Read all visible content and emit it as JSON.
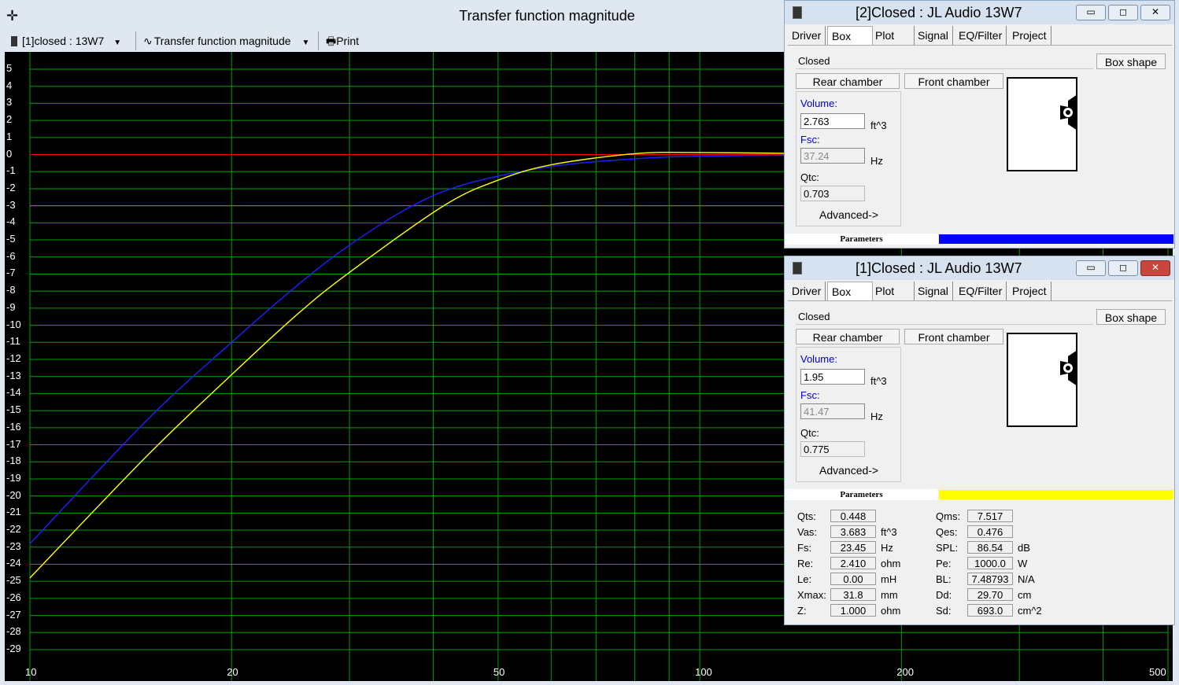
{
  "window": {
    "title": "Transfer function magnitude"
  },
  "toolbar": {
    "project_select": "[1]closed : 13W7",
    "view_select": "Transfer function magnitude",
    "print_label": "Print"
  },
  "chart_data": {
    "type": "line",
    "xscale": "log",
    "xlim": [
      10,
      500
    ],
    "ylim": [
      -29,
      5
    ],
    "grid": true,
    "x_ticks": [
      "10",
      "20",
      "50",
      "100",
      "200",
      "500"
    ],
    "y_ticks": [
      "5",
      "4",
      "3",
      "2",
      "1",
      "0",
      "-1",
      "-2",
      "-3",
      "-4",
      "-5",
      "-6",
      "-7",
      "-8",
      "-9",
      "-10",
      "-11",
      "-12",
      "-13",
      "-14",
      "-15",
      "-16",
      "-17",
      "-18",
      "-19",
      "-20",
      "-21",
      "-22",
      "-23",
      "-24",
      "-25",
      "-26",
      "-27",
      "-28",
      "-29"
    ],
    "reference_lines": [
      {
        "y": 0,
        "color": "#ff0000"
      },
      {
        "y": -3,
        "color": "#cc33cc"
      }
    ],
    "series": [
      {
        "color": "#2020ff",
        "x": [
          10,
          15,
          20,
          25,
          30,
          37.24,
          45,
          60,
          80,
          100,
          150,
          200,
          300,
          500
        ],
        "y": [
          -22.8,
          -15.5,
          -11.0,
          -7.7,
          -5.3,
          -3.0,
          -1.7,
          -0.7,
          -0.25,
          -0.1,
          -0.02,
          0,
          0,
          0
        ]
      },
      {
        "color": "#ffff00",
        "x": [
          10,
          15,
          20,
          25,
          30,
          41.47,
          50,
          60,
          80,
          100,
          150,
          200,
          300,
          500
        ],
        "y": [
          -24.8,
          -17.6,
          -12.9,
          -9.4,
          -6.9,
          -3.0,
          -1.5,
          -0.6,
          0.05,
          0.12,
          0.05,
          0.02,
          0,
          0
        ]
      }
    ]
  },
  "win2": {
    "title": "[2]Closed : JL Audio 13W7",
    "tabs": [
      "Driver",
      "Box",
      "Plot",
      "Signal",
      "EQ/Filter",
      "Project"
    ],
    "box_type": "Closed",
    "box_shape_label": "Box shape",
    "rear_label": "Rear chamber",
    "front_label": "Front chamber",
    "volume_label": "Volume:",
    "volume": "2.763",
    "volume_unit": "ft^3",
    "fsc_label": "Fsc:",
    "fsc": "37.24",
    "fsc_unit": "Hz",
    "qtc_label": "Qtc:",
    "qtc": "0.703",
    "advanced_label": "Advanced->",
    "params_label": "Parameters",
    "color": "#0000ff"
  },
  "win1": {
    "title": "[1]Closed : JL Audio 13W7",
    "tabs": [
      "Driver",
      "Box",
      "Plot",
      "Signal",
      "EQ/Filter",
      "Project"
    ],
    "box_type": "Closed",
    "box_shape_label": "Box shape",
    "rear_label": "Rear chamber",
    "front_label": "Front chamber",
    "volume_label": "Volume:",
    "volume": "1.95",
    "volume_unit": "ft^3",
    "fsc_label": "Fsc:",
    "fsc": "41.47",
    "fsc_unit": "Hz",
    "qtc_label": "Qtc:",
    "qtc": "0.775",
    "advanced_label": "Advanced->",
    "params_label": "Parameters",
    "color": "#ffff00",
    "params": {
      "left": [
        {
          "label": "Qts:",
          "value": "0.448",
          "unit": ""
        },
        {
          "label": "Vas:",
          "value": "3.683",
          "unit": "ft^3"
        },
        {
          "label": "Fs:",
          "value": "23.45",
          "unit": "Hz"
        },
        {
          "label": "Re:",
          "value": "2.410",
          "unit": "ohm"
        },
        {
          "label": "Le:",
          "value": "0.00",
          "unit": "mH"
        },
        {
          "label": "Xmax:",
          "value": "31.8",
          "unit": "mm"
        },
        {
          "label": "Z:",
          "value": "1.000",
          "unit": "ohm"
        }
      ],
      "right": [
        {
          "label": "Qms:",
          "value": "7.517",
          "unit": ""
        },
        {
          "label": "Qes:",
          "value": "0.476",
          "unit": ""
        },
        {
          "label": "SPL:",
          "value": "86.54",
          "unit": "dB"
        },
        {
          "label": "Pe:",
          "value": "1000.0",
          "unit": "W"
        },
        {
          "label": "BL:",
          "value": "7.48793",
          "unit": "N/A"
        },
        {
          "label": "Dd:",
          "value": "29.70",
          "unit": "cm"
        },
        {
          "label": "Sd:",
          "value": "693.0",
          "unit": "cm^2"
        }
      ]
    }
  }
}
